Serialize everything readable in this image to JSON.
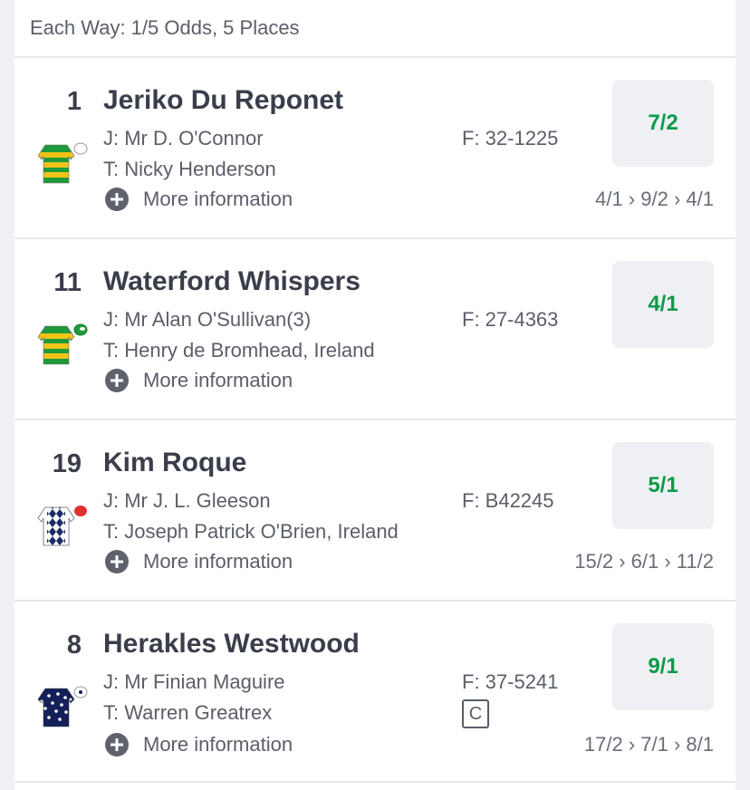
{
  "header": {
    "each_way": "Each Way: 1/5 Odds, 5 Places"
  },
  "runners": [
    {
      "number": "1",
      "name": "Jeriko Du Reponet",
      "jockey": "J: Mr D. O'Connor",
      "trainer": "T: Nicky Henderson",
      "form": "F: 32-1225",
      "odds": "7/2",
      "more_info": "More information",
      "price_history": "4/1 › 9/2 › 4/1",
      "silk": "green-yellow-hoops-silk-icon"
    },
    {
      "number": "11",
      "name": "Waterford Whispers",
      "jockey": "J: Mr Alan O'Sullivan(3)",
      "trainer": "T: Henry de Bromhead, Ireland",
      "form": "F: 27-4363",
      "odds": "4/1",
      "more_info": "More information",
      "price_history": "",
      "silk": "green-yellow-hoops-green-cap-silk-icon"
    },
    {
      "number": "19",
      "name": "Kim Roque",
      "jockey": "J: Mr J. L. Gleeson",
      "trainer": "T: Joseph Patrick O'Brien, Ireland",
      "form": "F: B42245",
      "odds": "5/1",
      "more_info": "More information",
      "price_history": "15/2 › 6/1 › 11/2",
      "silk": "navy-white-diamonds-red-cap-silk-icon"
    },
    {
      "number": "8",
      "name": "Herakles Westwood",
      "jockey": "J: Mr Finian Maguire",
      "trainer": "T: Warren Greatrex",
      "form": "F: 37-5241",
      "badge": "C",
      "odds": "9/1",
      "more_info": "More information",
      "price_history": "17/2 › 7/1 › 8/1",
      "silk": "navy-white-stars-silk-icon"
    }
  ],
  "colors": {
    "odds_text": "#0d9a49",
    "odds_button_bg": "#eef0f3",
    "text_primary": "#3a3d4a",
    "text_secondary": "#5b5e69"
  }
}
